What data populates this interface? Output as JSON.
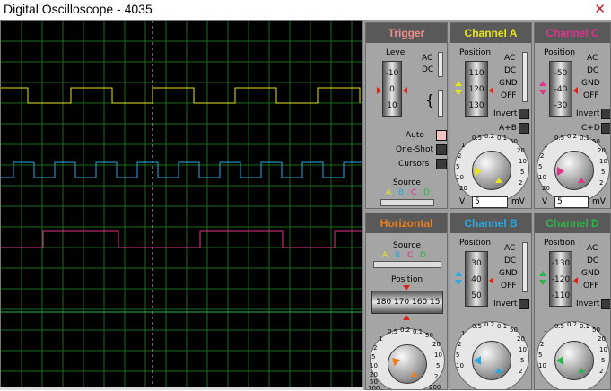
{
  "window": {
    "title": "Digital Oscilloscope - 4035",
    "close_glyph": "✕"
  },
  "colors": {
    "channel_a": "#e6e61a",
    "channel_b": "#29a8e0",
    "channel_c": "#e0338a",
    "channel_d": "#2db34a",
    "trigger_header": "#f08c8c",
    "horizontal_header": "#f07c1a",
    "grid": "#1d6b1d",
    "screen_bg": "#000000"
  },
  "trigger": {
    "title": "Trigger",
    "level_label": "Level",
    "level_ticks": [
      "-10",
      "0",
      "10"
    ],
    "ac": "AC",
    "dc": "DC",
    "auto": "Auto",
    "one_shot": "One-Shot",
    "cursors": "Cursors",
    "source_label": "Source",
    "sources": [
      "A",
      "B",
      "C",
      "D"
    ]
  },
  "channel_a": {
    "title": "Channel A",
    "position_label": "Position",
    "drum": [
      "110",
      "120",
      "130"
    ],
    "ac": "AC",
    "dc": "DC",
    "gnd": "GND",
    "off": "OFF",
    "invert": "Invert",
    "combine": "A+B",
    "scale": [
      "0.5",
      "0.2",
      "0.1",
      "50",
      "20",
      "10",
      "5",
      "2",
      "1",
      "2",
      "5",
      "10",
      "20"
    ],
    "v_label": "V",
    "value": "5",
    "unit": "mV"
  },
  "channel_c": {
    "title": "Channel C",
    "position_label": "Position",
    "drum": [
      "-50",
      "-40",
      "-30"
    ],
    "ac": "AC",
    "dc": "DC",
    "gnd": "GND",
    "off": "OFF",
    "invert": "Invert",
    "combine": "C+D",
    "scale": [
      "0.5",
      "0.2",
      "0.1",
      "50",
      "20",
      "10",
      "5",
      "2",
      "1",
      "2",
      "5",
      "10",
      "20"
    ],
    "v_label": "V",
    "value": "5",
    "unit": "mV"
  },
  "horizontal": {
    "title": "Horizontal",
    "source_label": "Source",
    "sources": [
      "A",
      "B",
      "C",
      "D"
    ],
    "position_label": "Position",
    "drum": [
      "180",
      "170",
      "160",
      "15"
    ],
    "scale": [
      "0.5",
      "0.2",
      "0.1",
      "50",
      "20",
      "10",
      "5",
      "2",
      "1",
      "2",
      "5",
      "10",
      "20",
      "50",
      "100",
      "200"
    ]
  },
  "channel_b": {
    "title": "Channel B",
    "position_label": "Position",
    "drum": [
      "30",
      "40",
      "50"
    ],
    "ac": "AC",
    "dc": "DC",
    "gnd": "GND",
    "off": "OFF",
    "invert": "Invert",
    "scale": [
      "0.5",
      "0.2",
      "0.1",
      "50",
      "20",
      "10",
      "5",
      "2",
      "1",
      "2",
      "5",
      "10"
    ]
  },
  "channel_d": {
    "title": "Channel D",
    "position_label": "Position",
    "drum": [
      "-130",
      "-120",
      "-110"
    ],
    "ac": "AC",
    "dc": "DC",
    "gnd": "GND",
    "off": "OFF",
    "invert": "Invert",
    "scale": [
      "0.5",
      "0.2",
      "0.1",
      "50",
      "20",
      "10",
      "5",
      "2",
      "1",
      "2",
      "5",
      "10"
    ]
  }
}
